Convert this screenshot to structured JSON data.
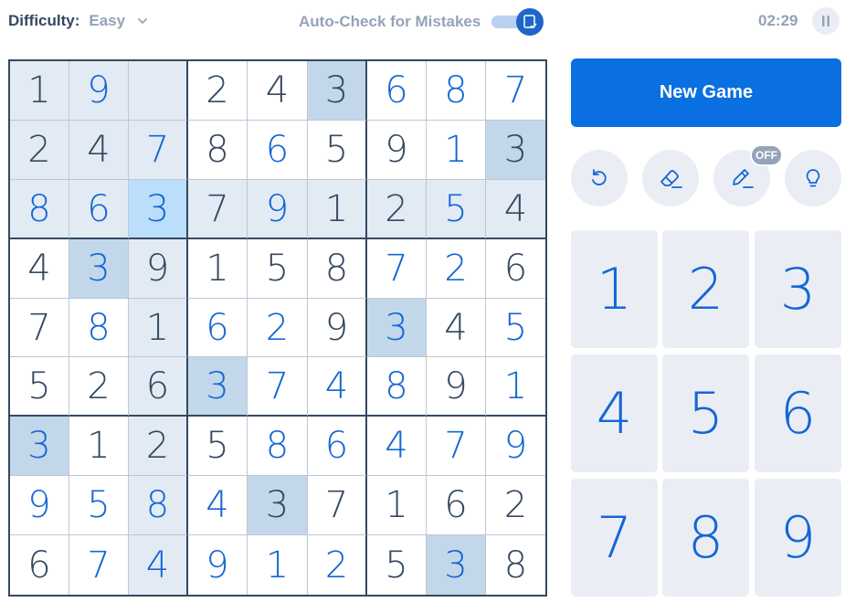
{
  "header": {
    "difficulty_label": "Difficulty:",
    "difficulty_value": "Easy",
    "autocheck_label": "Auto-Check for Mistakes",
    "autocheck_on": true,
    "timer": "02:29"
  },
  "board": {
    "values": [
      [
        "1",
        "9",
        "",
        "2",
        "4",
        "3",
        "6",
        "8",
        "7"
      ],
      [
        "2",
        "4",
        "7",
        "8",
        "6",
        "5",
        "9",
        "1",
        "3"
      ],
      [
        "8",
        "6",
        "3",
        "7",
        "9",
        "1",
        "2",
        "5",
        "4"
      ],
      [
        "4",
        "3",
        "9",
        "1",
        "5",
        "8",
        "7",
        "2",
        "6"
      ],
      [
        "7",
        "8",
        "1",
        "6",
        "2",
        "9",
        "3",
        "4",
        "5"
      ],
      [
        "5",
        "2",
        "6",
        "3",
        "7",
        "4",
        "8",
        "9",
        "1"
      ],
      [
        "3",
        "1",
        "2",
        "5",
        "8",
        "6",
        "4",
        "7",
        "9"
      ],
      [
        "9",
        "5",
        "8",
        "4",
        "3",
        "7",
        "1",
        "6",
        "2"
      ],
      [
        "6",
        "7",
        "4",
        "9",
        "1",
        "2",
        "5",
        "3",
        "8"
      ]
    ],
    "kind": [
      [
        "g",
        "u",
        "g",
        "g",
        "g",
        "g",
        "u",
        "u",
        "u"
      ],
      [
        "g",
        "g",
        "u",
        "g",
        "u",
        "g",
        "g",
        "u",
        "g"
      ],
      [
        "u",
        "u",
        "u",
        "g",
        "u",
        "g",
        "g",
        "u",
        "g"
      ],
      [
        "g",
        "u",
        "g",
        "g",
        "g",
        "g",
        "u",
        "u",
        "g"
      ],
      [
        "g",
        "u",
        "g",
        "u",
        "u",
        "g",
        "u",
        "g",
        "u"
      ],
      [
        "g",
        "g",
        "g",
        "u",
        "u",
        "u",
        "u",
        "g",
        "u"
      ],
      [
        "u",
        "g",
        "g",
        "g",
        "u",
        "u",
        "u",
        "u",
        "u"
      ],
      [
        "u",
        "u",
        "u",
        "u",
        "g",
        "g",
        "g",
        "g",
        "g"
      ],
      [
        "g",
        "u",
        "u",
        "u",
        "u",
        "u",
        "g",
        "u",
        "g"
      ]
    ],
    "highlight": [
      [
        "r",
        "r",
        "r",
        "p",
        "p",
        "s",
        "p",
        "p",
        "p"
      ],
      [
        "r",
        "r",
        "r",
        "p",
        "p",
        "p",
        "p",
        "p",
        "s"
      ],
      [
        "r",
        "r",
        "x",
        "r",
        "r",
        "r",
        "r",
        "r",
        "r"
      ],
      [
        "p",
        "s",
        "r",
        "p",
        "p",
        "p",
        "p",
        "p",
        "p"
      ],
      [
        "p",
        "p",
        "r",
        "p",
        "p",
        "p",
        "s",
        "p",
        "p"
      ],
      [
        "p",
        "p",
        "r",
        "s",
        "p",
        "p",
        "p",
        "p",
        "p"
      ],
      [
        "s",
        "p",
        "r",
        "p",
        "p",
        "p",
        "p",
        "p",
        "p"
      ],
      [
        "p",
        "p",
        "r",
        "p",
        "s",
        "p",
        "p",
        "p",
        "p"
      ],
      [
        "p",
        "p",
        "r",
        "p",
        "p",
        "p",
        "p",
        "s",
        "p"
      ]
    ]
  },
  "controls": {
    "new_game_label": "New Game",
    "tools": [
      {
        "name": "undo",
        "icon": "undo-icon"
      },
      {
        "name": "erase",
        "icon": "eraser-icon"
      },
      {
        "name": "notes",
        "icon": "pencil-icon"
      },
      {
        "name": "hint",
        "icon": "lightbulb-icon"
      }
    ],
    "notes_badge": "OFF",
    "numbers": [
      "1",
      "2",
      "3",
      "4",
      "5",
      "6",
      "7",
      "8",
      "9"
    ]
  },
  "colors": {
    "accent": "#0a6fe0",
    "given_text": "#344861",
    "user_text": "#1466d6",
    "related_bg": "#e2ebf3",
    "same_number_bg": "#c3d7ea",
    "selected_bg": "#bbdefb"
  }
}
